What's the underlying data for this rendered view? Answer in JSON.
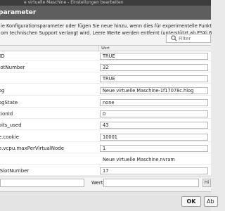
{
  "window": {
    "title": "e virtuelle Maschine - Einstellungen bearbeiten"
  },
  "dialog": {
    "title": "parameter",
    "description_line1": "ie Konfigurationsparameter oder fügen Sie neue hinzu, wenn dies für experimentelle Funktionen e",
    "description_line2": "om technischen Support verlangt wird. Leere Werte werden entfernt (unterstützt ab ESXi 6.0)."
  },
  "filter": {
    "placeholder": "Filter"
  },
  "grid": {
    "value_column_header": "Wert",
    "rows": [
      {
        "name": "UID",
        "value": "TRUE"
      },
      {
        "name": "SlotNumber",
        "value": "32"
      },
      {
        "name": "t",
        "value": "TRUE"
      },
      {
        "name": "Log",
        "value": "Neue virtuelle Maschine-1f17078c.hlog"
      },
      {
        "name": "LogState",
        "value": "none"
      },
      {
        "name": "ationId",
        "value": "0"
      },
      {
        "name": "_bits_used",
        "value": "43"
      },
      {
        "name": "ce.cookie",
        "value": "10001"
      },
      {
        "name": "ce.vcpu.maxPerVirtualNode",
        "value": "1"
      },
      {
        "name": "",
        "value": "Neue virtuelle Maschine.nvram"
      },
      {
        "name": "ciSlotNumber",
        "value": "17"
      }
    ]
  },
  "add_row": {
    "value_label": "Wert:",
    "add_label": "Hi"
  },
  "footer": {
    "ok_label": "OK",
    "cancel_label": "Ab"
  }
}
